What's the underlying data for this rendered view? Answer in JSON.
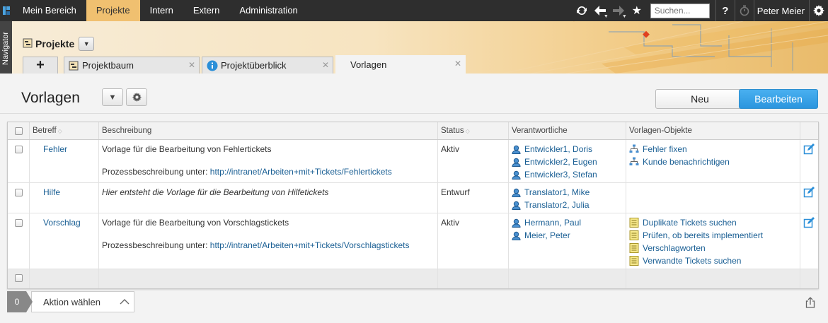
{
  "nav": {
    "items": [
      {
        "label": "Mein Bereich",
        "active": false
      },
      {
        "label": "Projekte",
        "active": true
      },
      {
        "label": "Intern",
        "active": false
      },
      {
        "label": "Extern",
        "active": false
      },
      {
        "label": "Administration",
        "active": false
      }
    ],
    "search_placeholder": "Suchen...",
    "help_label": "?",
    "user_name": "Peter Meier"
  },
  "navigator_label": "Navigator",
  "project": {
    "title": "Projekte"
  },
  "tabs": [
    {
      "label": "Projektbaum",
      "icon": "project-tree-icon"
    },
    {
      "label": "Projektüberblick",
      "icon": "info-icon"
    },
    {
      "label": "Vorlagen",
      "icon": "",
      "active": true
    }
  ],
  "page": {
    "title": "Vorlagen",
    "new_label": "Neu",
    "edit_label": "Bearbeiten"
  },
  "table": {
    "headers": {
      "subject": "Betreff",
      "description": "Beschreibung",
      "status": "Status",
      "responsible": "Verantwortliche",
      "objects": "Vorlagen-Objekte"
    },
    "rows": [
      {
        "subject": "Fehler",
        "desc_line1": "Vorlage für die Bearbeitung von Fehlertickets",
        "desc_prefix": "Prozessbeschreibung unter: ",
        "desc_link": "http://intranet/Arbeiten+mit+Tickets/Fehlertickets",
        "status": "Aktiv",
        "people": [
          "Entwickler1, Doris",
          "Entwickler2, Eugen",
          "Entwickler3, Stefan"
        ],
        "objects": [
          "Fehler fixen",
          "Kunde benachrichtigen"
        ]
      },
      {
        "subject": "Hilfe",
        "desc_line1": "Hier entsteht die Vorlage für die Bearbeitung von Hilfetickets",
        "status": "Entwurf",
        "people": [
          "Translator1, Mike",
          "Translator2, Julia"
        ],
        "objects": []
      },
      {
        "subject": "Vorschlag",
        "desc_line1": "Vorlage für die Bearbeitung von Vorschlagstickets",
        "desc_prefix": "Prozessbeschreibung unter: ",
        "desc_link": "http://intranet/Arbeiten+mit+Tickets/Vorschlagstickets",
        "status": "Aktiv",
        "people": [
          "Hermann, Paul",
          "Meier, Peter"
        ],
        "objects": [
          "Duplikate Tickets suchen",
          "Prüfen, ob bereits implementiert",
          "Verschlagworten",
          "Verwandte Tickets suchen"
        ]
      }
    ]
  },
  "footer": {
    "selected_count": "0",
    "action_label": "Aktion wählen"
  },
  "colors": {
    "topnav": "#2e2e2e",
    "active_nav": "#f0c070",
    "primary_button": "#2b95de",
    "link": "#1a5f94"
  }
}
